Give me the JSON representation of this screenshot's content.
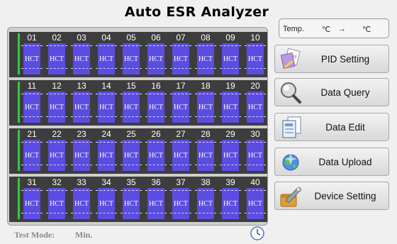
{
  "app": {
    "title": "Auto ESR Analyzer"
  },
  "temperature": {
    "label": "Temp.",
    "from_unit": "℃",
    "arrow": "→",
    "to_unit": "℃"
  },
  "rack": {
    "rows": [
      {
        "channels": [
          "01",
          "02",
          "03",
          "04",
          "05",
          "06",
          "07",
          "08",
          "09",
          "10"
        ]
      },
      {
        "channels": [
          "11",
          "12",
          "13",
          "14",
          "15",
          "16",
          "17",
          "18",
          "19",
          "20"
        ]
      },
      {
        "channels": [
          "21",
          "22",
          "23",
          "24",
          "25",
          "26",
          "27",
          "28",
          "29",
          "30"
        ]
      },
      {
        "channels": [
          "31",
          "32",
          "33",
          "34",
          "35",
          "36",
          "37",
          "38",
          "39",
          "40"
        ]
      }
    ],
    "tube_label": "HCT"
  },
  "buttons": [
    {
      "label": "PID Setting",
      "icon": "css-document-icon"
    },
    {
      "label": "Data Query",
      "icon": "magnifier-icon"
    },
    {
      "label": "Data Edit",
      "icon": "document-edit-icon"
    },
    {
      "label": "Data Upload",
      "icon": "globe-upload-icon"
    },
    {
      "label": "Device Setting",
      "icon": "wrench-icon"
    }
  ],
  "status": {
    "test_mode_label": "Test Mode:",
    "duration_unit": "Min."
  },
  "colors": {
    "tube": "#5b4de2",
    "rack_row": "#3d3d3d",
    "indicator": "#2ecc40"
  }
}
